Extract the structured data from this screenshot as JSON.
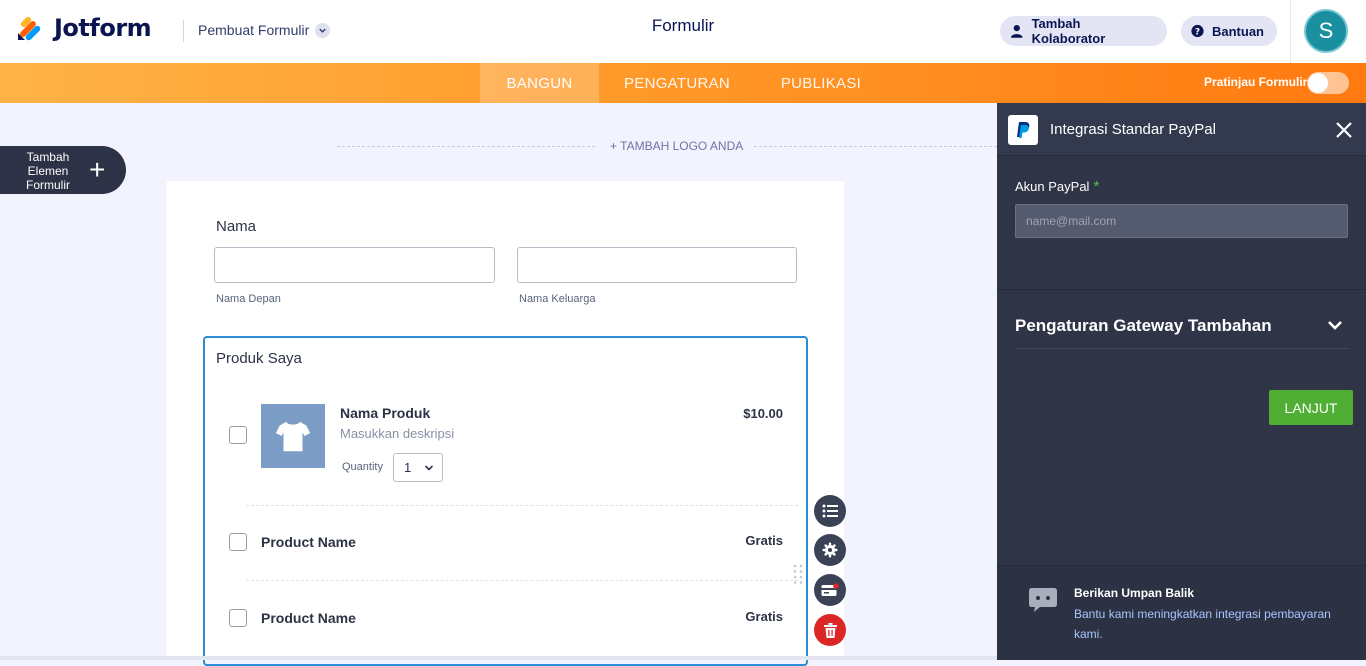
{
  "header": {
    "logo_text": "Jotform",
    "maker_label": "Pembuat Formulir",
    "page_title": "Formulir",
    "collaborator_label": "Tambah Kolaborator",
    "help_label": "Bantuan",
    "avatar_initial": "S",
    "brand_colors": {
      "navy": "#0a1551",
      "orange": "#ff6100",
      "blue": "#0099ff",
      "yellow": "#ffb629"
    }
  },
  "tabs": [
    {
      "label": "BANGUN",
      "active": true
    },
    {
      "label": "PENGATURAN",
      "active": false
    },
    {
      "label": "PUBLIKASI",
      "active": false
    }
  ],
  "preview": {
    "label": "Pratinjau Formulir",
    "enabled": false
  },
  "canvas": {
    "add_element_label": "Tambah Elemen Formulir",
    "add_logo_label": "+ TAMBAH LOGO ANDA"
  },
  "form": {
    "name_field": {
      "label": "Nama",
      "first_sublabel": "Nama Depan",
      "last_sublabel": "Nama Keluarga"
    },
    "products": {
      "label": "Produk Saya",
      "items": [
        {
          "name": "Nama Produk",
          "description": "Masukkan deskripsi",
          "price": "$10.00",
          "quantity_label": "Quantity",
          "quantity": "1"
        },
        {
          "name": "Product Name",
          "price": "Gratis"
        },
        {
          "name": "Product Name",
          "price": "Gratis"
        }
      ]
    }
  },
  "toolbar_icons": [
    "list-icon",
    "gear-icon",
    "payment-card-icon",
    "trash-icon"
  ],
  "panel": {
    "title": "Integrasi Standar PayPal",
    "account_label": "Akun PayPal",
    "required_mark": "*",
    "account_placeholder": "name@mail.com",
    "gateway_settings_label": "Pengaturan Gateway Tambahan",
    "next_button": "LANJUT",
    "feedback": {
      "title": "Berikan Umpan Balik",
      "text": "Bantu kami meningkatkan integrasi pembayaran kami."
    }
  }
}
